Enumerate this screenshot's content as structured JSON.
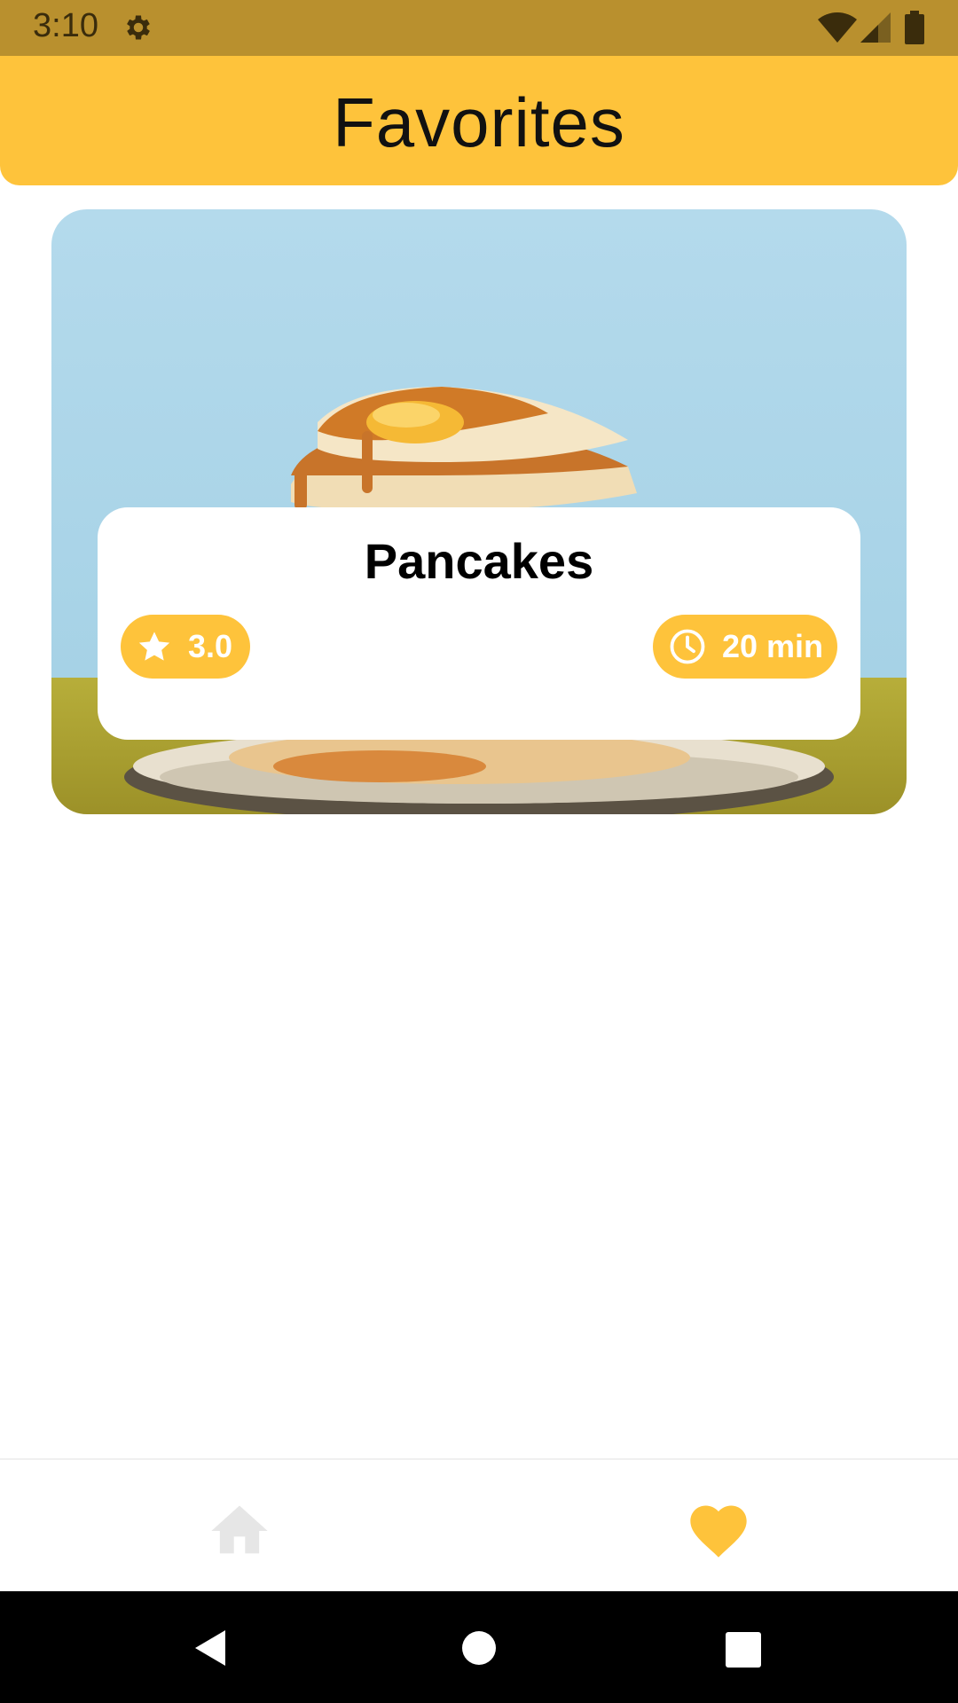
{
  "status_bar": {
    "time": "3:10",
    "background": "#B9902E",
    "icons": [
      "gear-icon",
      "wifi-icon",
      "signal-icon",
      "battery-icon"
    ]
  },
  "header": {
    "title": "Favorites",
    "background": "#FEC33B"
  },
  "recipes": [
    {
      "name": "Pancakes",
      "rating": "3.0",
      "time": "20 min",
      "image": "pancakes-photo",
      "accent": "#FEC33B"
    }
  ],
  "bottom_nav": {
    "items": [
      {
        "icon": "home-icon",
        "selected": false
      },
      {
        "icon": "heart-icon",
        "selected": true
      }
    ],
    "selected_color": "#FEC33B",
    "unselected_color": "#E6E6E6"
  },
  "system_nav": {
    "icons": [
      "back-icon",
      "home-circle-icon",
      "recents-icon"
    ]
  }
}
